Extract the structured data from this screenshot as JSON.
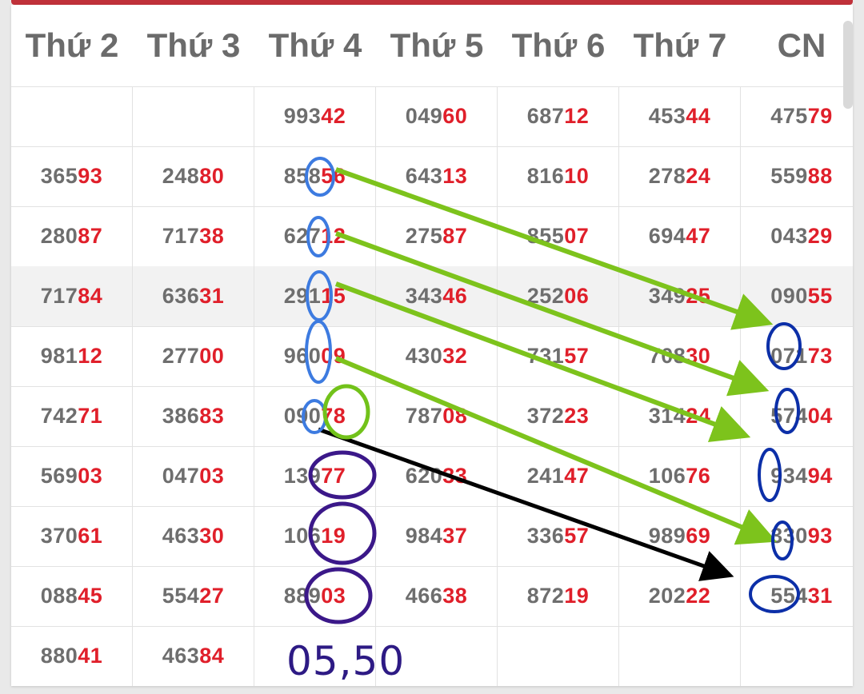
{
  "header": [
    "Thứ 2",
    "Thứ 3",
    "Thứ 4",
    "Thứ 5",
    "Thứ 6",
    "Thứ 7",
    "CN"
  ],
  "rows": [
    [
      "",
      "",
      "99342",
      "04960",
      "68712",
      "45344",
      "47579"
    ],
    [
      "36593",
      "24880",
      "85856",
      "64313",
      "81610",
      "27824",
      "55988"
    ],
    [
      "28087",
      "71738",
      "62712",
      "27587",
      "85507",
      "69447",
      "04329"
    ],
    [
      "71784",
      "63631",
      "29115",
      "34346",
      "25206",
      "34925",
      "09055"
    ],
    [
      "98112",
      "27700",
      "96009",
      "43032",
      "73157",
      "70830",
      "07173"
    ],
    [
      "74271",
      "38683",
      "09078",
      "78708",
      "37223",
      "31424",
      "57404"
    ],
    [
      "56903",
      "04703",
      "13977",
      "62033",
      "24147",
      "10676",
      "93494"
    ],
    [
      "37061",
      "46330",
      "10619",
      "98437",
      "33657",
      "98969",
      "33093"
    ],
    [
      "08845",
      "55427",
      "88903",
      "46638",
      "87219",
      "20222",
      "55431"
    ],
    [
      "88041",
      "46384",
      "",
      "",
      "",
      "",
      ""
    ]
  ],
  "note": "05,50",
  "colors": {
    "accent": "#c0313a",
    "suffix": "#e01f2a",
    "prefix": "#6e6e6e",
    "arrow_green": "#7dc31c",
    "arrow_black": "#000000",
    "circle_blue_light": "#3d7be0",
    "circle_blue_dark": "#0c2fa8",
    "circle_purple": "#3b1889",
    "circle_green": "#72c21a"
  }
}
